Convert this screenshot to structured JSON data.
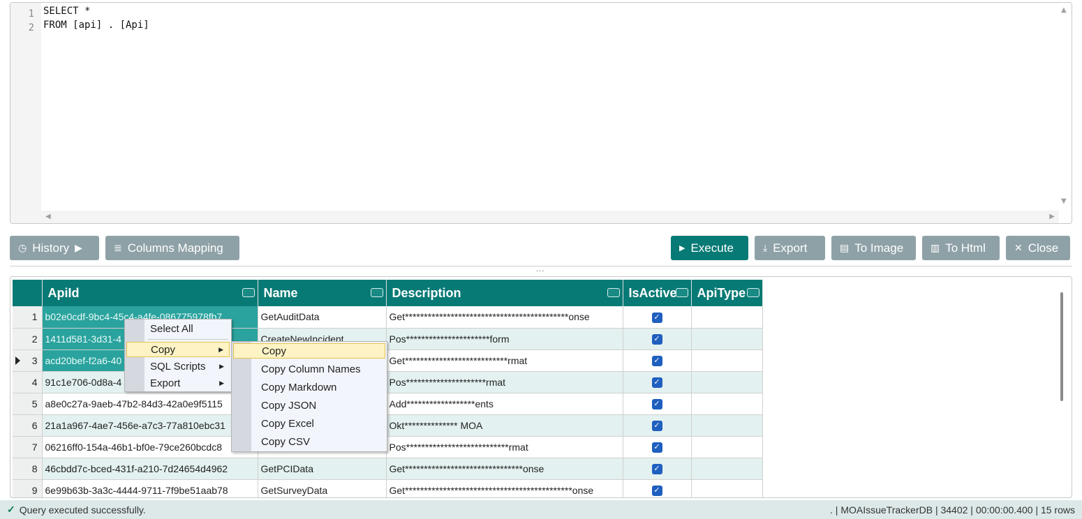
{
  "editor": {
    "line_numbers": [
      "1",
      "2"
    ],
    "lines": [
      "SELECT *",
      "FROM [api] . [Api]"
    ]
  },
  "toolbar": {
    "history": "History",
    "columns_mapping": "Columns Mapping",
    "execute": "Execute",
    "export": "Export",
    "to_image": "To Image",
    "to_html": "To Html",
    "close": "Close",
    "accent": "#087a75"
  },
  "grid": {
    "columns": [
      "ApiId",
      "Name",
      "Description",
      "IsActive",
      "ApiType"
    ],
    "rows": [
      {
        "num": "1",
        "apiid": "b02e0cdf-9bc4-45c4-a4fe-086775978fb7",
        "name": "GetAuditData",
        "desc": "Get*******************************************onse"
      },
      {
        "num": "2",
        "apiid": "1411d581-3d31-4",
        "name": "CreateNewIncident",
        "desc": "Pos**********************form"
      },
      {
        "num": "3",
        "apiid": "acd20bef-f2a6-40",
        "name": "",
        "desc": "Get***************************rmat"
      },
      {
        "num": "4",
        "apiid": "91c1e706-0d8a-4",
        "name": "",
        "desc": "Pos*********************rmat"
      },
      {
        "num": "5",
        "apiid": "a8e0c27a-9aeb-47b2-84d3-42a0e9f5115",
        "name": "",
        "desc": "Add******************ents"
      },
      {
        "num": "6",
        "apiid": "21a1a967-4ae7-456e-a7c3-77a810ebc31",
        "name": "",
        "desc": "Okt************** MOA"
      },
      {
        "num": "7",
        "apiid": "06216ff0-154a-46b1-bf0e-79ce260bcdc8",
        "name": "",
        "desc": "Pos***************************rmat"
      },
      {
        "num": "8",
        "apiid": "46cbdd7c-bced-431f-a210-7d24654d4962",
        "name": "GetPCIData",
        "desc": "Get*******************************onse"
      },
      {
        "num": "9",
        "apiid": "6e99b63b-3a3c-4444-9711-7f9be51aab78",
        "name": "GetSurveyData",
        "desc": "Get********************************************onse"
      }
    ]
  },
  "context_menu": {
    "items": [
      "Select All",
      "Copy",
      "SQL Scripts",
      "Export"
    ]
  },
  "copy_submenu": {
    "items": [
      "Copy",
      "Copy Column Names",
      "Copy Markdown",
      "Copy JSON",
      "Copy Excel",
      "Copy CSV"
    ]
  },
  "status": {
    "message": "Query executed successfully.",
    "info": ". | MOAIssueTrackerDB | 34402 | 00:00:00.400 | 15 rows"
  }
}
